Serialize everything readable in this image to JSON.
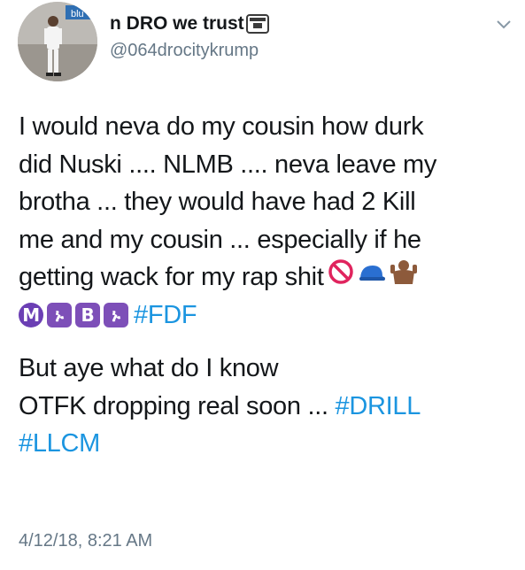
{
  "tweet": {
    "display_name": "n DRO we trust",
    "handle": "@064drocitykrump",
    "avatar_sign_text": "blu",
    "lines": [
      "I would neva do my cousin how durk",
      "did Nuski .... NLMB .... neva leave my",
      "brotha ... they would have had 2 Kill",
      "me and my cousin ... especially if he",
      "getting wack for my rap shit"
    ],
    "emoji_badges": [
      "M",
      "ኑ",
      "B",
      "ኑ"
    ],
    "hashtag_fdf": "#FDF",
    "line2_a": "But aye what do I know",
    "line2_b": "OTFK dropping real soon ... ",
    "hashtag_drill": "#DRILL",
    "hashtag_llcm": "#LLCM",
    "timestamp": "4/12/18, 8:21 AM"
  },
  "colors": {
    "text": "#14171a",
    "secondary": "#657786",
    "link": "#1b95e0",
    "badge": "#7d4fb8"
  }
}
